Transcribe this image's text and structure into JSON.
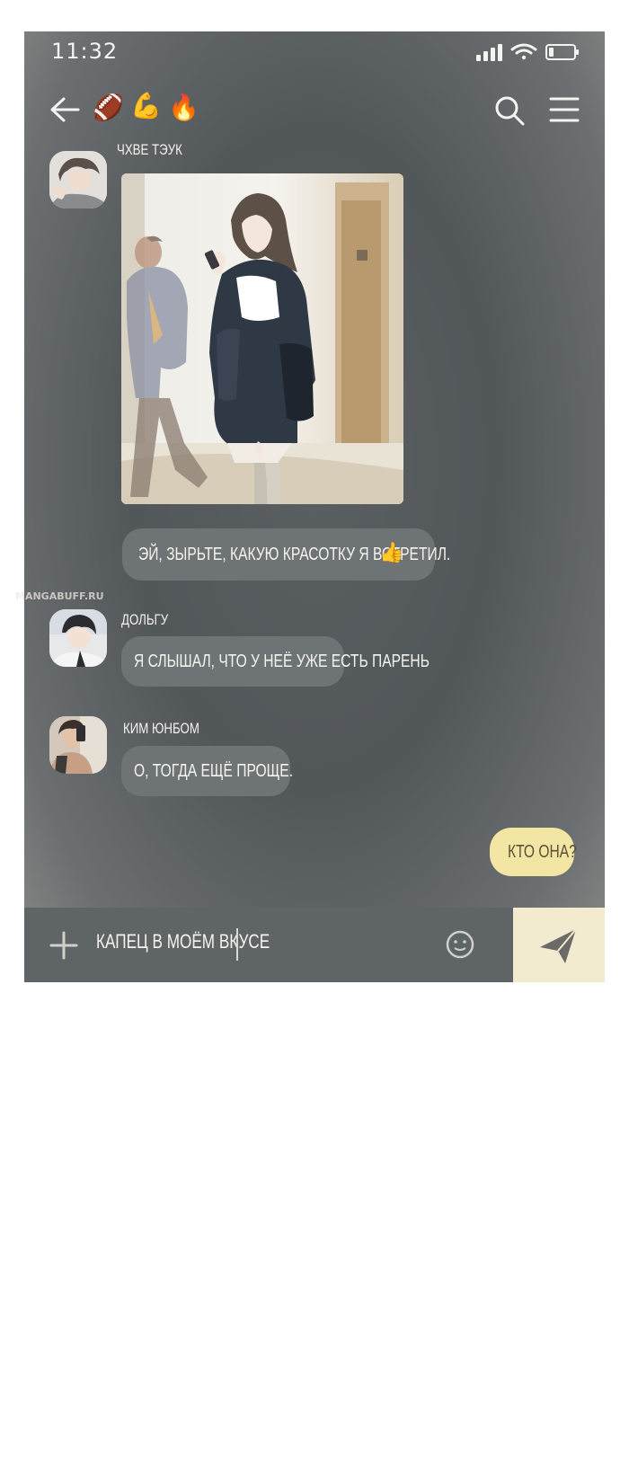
{
  "status_bar": {
    "time": "11:32"
  },
  "header": {
    "emojis": [
      "🏈",
      "💪",
      "🔥"
    ],
    "icons": [
      "back-arrow-icon",
      "search-icon",
      "menu-icon"
    ]
  },
  "messages": [
    {
      "sender": "ЧХВЕ ТЭУК",
      "type": "image",
      "image_description_icon": "photo-girl-with-phone"
    },
    {
      "sender": "",
      "type": "text",
      "text": "ЭЙ, ЗЫРЬТЕ, КАКУЮ КРАСОТКУ Я ВСТРЕТИЛ.",
      "emoji": "👍"
    },
    {
      "sender": "ДОЛЬГУ",
      "type": "text",
      "text": "Я СЛЫШАЛ, ЧТО У НЕЁ УЖЕ ЕСТЬ ПАРЕНЬ"
    },
    {
      "sender": "КИМ ЮНБОМ",
      "type": "text",
      "text": "О, ТОГДА ЕЩЁ ПРОЩЕ."
    },
    {
      "sender": "",
      "type": "text",
      "mine": true,
      "text": "КТО ОНА?"
    }
  ],
  "input": {
    "value": "КАПЕЦ В МОЁМ ВКУСЕ"
  },
  "watermark": {
    "text": "MANGABUFF.RU"
  },
  "colors": {
    "screen_bg": "#55595c",
    "bubble_other": "#6e7476",
    "bubble_mine": "#f3e6a4",
    "send_button": "#f2ebcf",
    "text_light": "#f5f3ee"
  }
}
